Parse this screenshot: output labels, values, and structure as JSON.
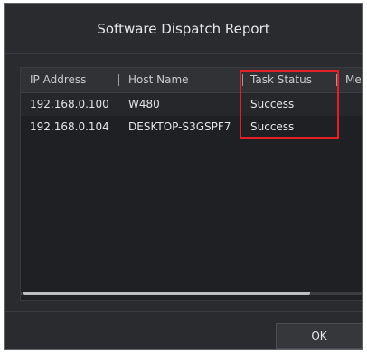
{
  "dialog": {
    "title": "Software Dispatch Report"
  },
  "table": {
    "columns": [
      "IP Address",
      "Host Name",
      "Task Status",
      "Mes"
    ],
    "rows": [
      [
        "192.168.0.100",
        "W480",
        "Success"
      ],
      [
        "192.168.0.104",
        "DESKTOP-S3GSPF7",
        "Success"
      ]
    ]
  },
  "footer": {
    "ok_label": "OK"
  },
  "colors": {
    "dialog_bg": "#2a2b2e",
    "table_bg": "#1f2023",
    "header_bg": "#303236",
    "highlight": "#e01f26"
  }
}
